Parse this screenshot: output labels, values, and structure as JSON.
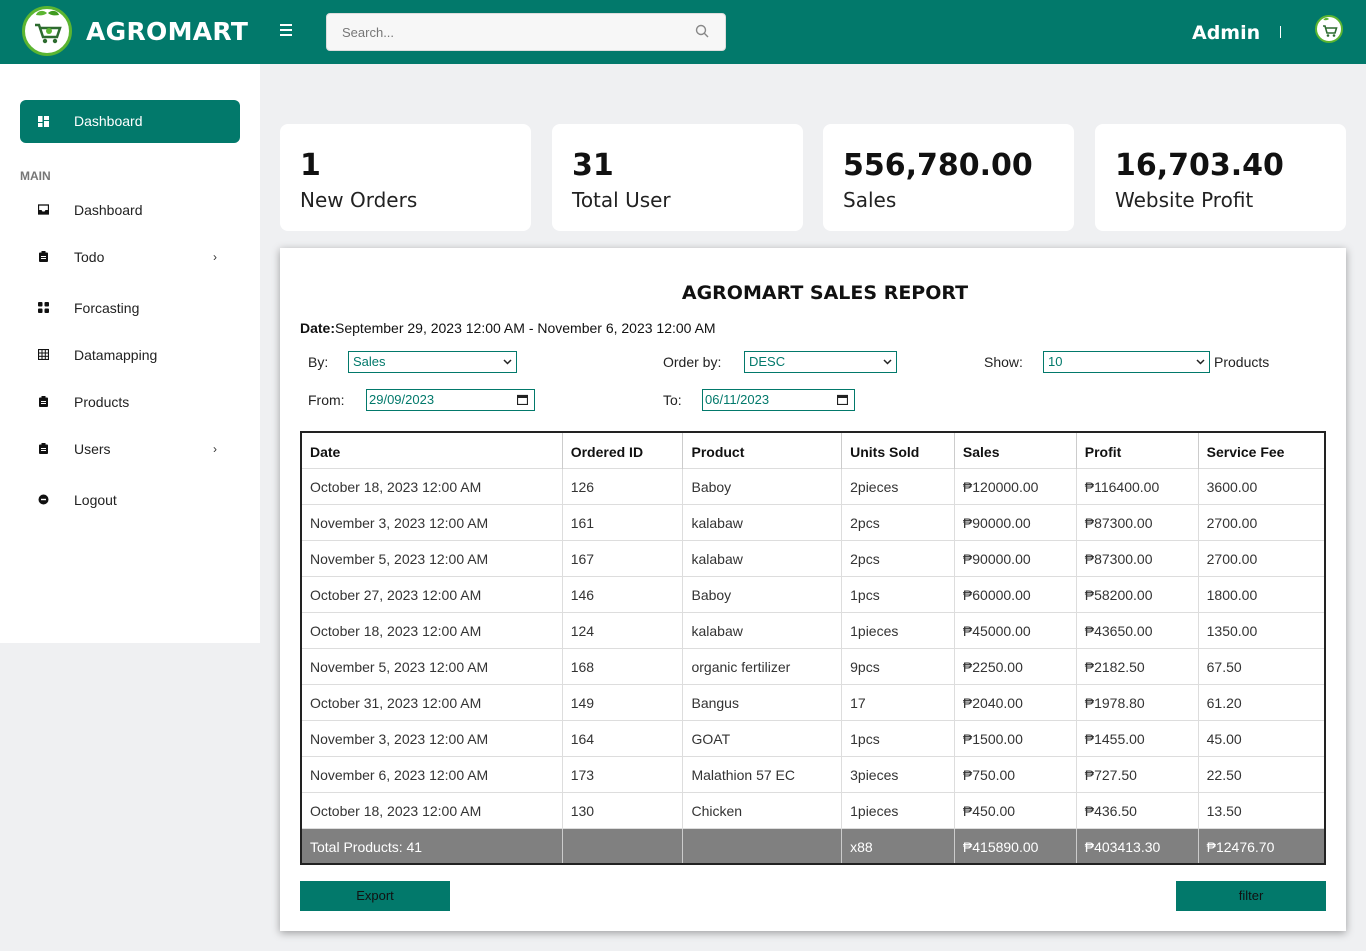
{
  "header": {
    "app_title": "AGROMART",
    "search_placeholder": "Search...",
    "user_name": "Admin"
  },
  "sidebar": {
    "active_item": "Dashboard",
    "section_label": "MAIN",
    "items": [
      {
        "label": "Dashboard",
        "icon": "inbox-icon",
        "has_submenu": false
      },
      {
        "label": "Todo",
        "icon": "clipboard-icon",
        "has_submenu": true
      },
      {
        "label": "Forcasting",
        "icon": "grid-icon",
        "has_submenu": false
      },
      {
        "label": "Datamapping",
        "icon": "table-icon",
        "has_submenu": false
      },
      {
        "label": "Products",
        "icon": "clipboard-icon",
        "has_submenu": false
      },
      {
        "label": "Users",
        "icon": "clipboard-icon",
        "has_submenu": true
      },
      {
        "label": "Logout",
        "icon": "logout-icon",
        "has_submenu": false
      }
    ]
  },
  "stats": [
    {
      "value": "1",
      "label": "New Orders"
    },
    {
      "value": "31",
      "label": "Total User"
    },
    {
      "value": "556,780.00",
      "label": "Sales"
    },
    {
      "value": "16,703.40",
      "label": "Website Profit"
    }
  ],
  "report": {
    "title": "AGROMART SALES REPORT",
    "date_label": "Date:",
    "date_range": "September 29, 2023 12:00 AM - November 6, 2023 12:00 AM",
    "filters": {
      "by_label": "By:",
      "by_value": "Sales",
      "order_label": "Order by:",
      "order_value": "DESC",
      "show_label": "Show:",
      "show_value": "10",
      "show_suffix": "Products",
      "from_label": "From:",
      "from_value": "29/09/2023",
      "to_label": "To:",
      "to_value": "06/11/2023"
    },
    "columns": [
      "Date",
      "Ordered ID",
      "Product",
      "Units Sold",
      "Sales",
      "Profit",
      "Service Fee"
    ],
    "rows": [
      [
        "October 18, 2023 12:00 AM",
        "126",
        "Baboy",
        "2pieces",
        "₱120000.00",
        "₱116400.00",
        "3600.00"
      ],
      [
        "November 3, 2023 12:00 AM",
        "161",
        "kalabaw",
        "2pcs",
        "₱90000.00",
        "₱87300.00",
        "2700.00"
      ],
      [
        "November 5, 2023 12:00 AM",
        "167",
        "kalabaw",
        "2pcs",
        "₱90000.00",
        "₱87300.00",
        "2700.00"
      ],
      [
        "October 27, 2023 12:00 AM",
        "146",
        "Baboy",
        "1pcs",
        "₱60000.00",
        "₱58200.00",
        "1800.00"
      ],
      [
        "October 18, 2023 12:00 AM",
        "124",
        "kalabaw",
        "1pieces",
        "₱45000.00",
        "₱43650.00",
        "1350.00"
      ],
      [
        "November 5, 2023 12:00 AM",
        "168",
        "organic fertilizer",
        "9pcs",
        "₱2250.00",
        "₱2182.50",
        "67.50"
      ],
      [
        "October 31, 2023 12:00 AM",
        "149",
        "Bangus",
        "17",
        "₱2040.00",
        "₱1978.80",
        "61.20"
      ],
      [
        "November 3, 2023 12:00 AM",
        "164",
        "GOAT",
        "1pcs",
        "₱1500.00",
        "₱1455.00",
        "45.00"
      ],
      [
        "November 6, 2023 12:00 AM",
        "173",
        "Malathion 57 EC",
        "3pieces",
        "₱750.00",
        "₱727.50",
        "22.50"
      ],
      [
        "October 18, 2023 12:00 AM",
        "130",
        "Chicken",
        "1pieces",
        "₱450.00",
        "₱436.50",
        "13.50"
      ]
    ],
    "total": [
      "Total Products: 41",
      "",
      "",
      "x88",
      "₱415890.00",
      "₱403413.30",
      "₱12476.70"
    ],
    "export_label": "Export",
    "filter_label": "filter"
  },
  "colors": {
    "primary": "#02796b",
    "total_row": "#808080",
    "accent_green": "#5bb531"
  }
}
